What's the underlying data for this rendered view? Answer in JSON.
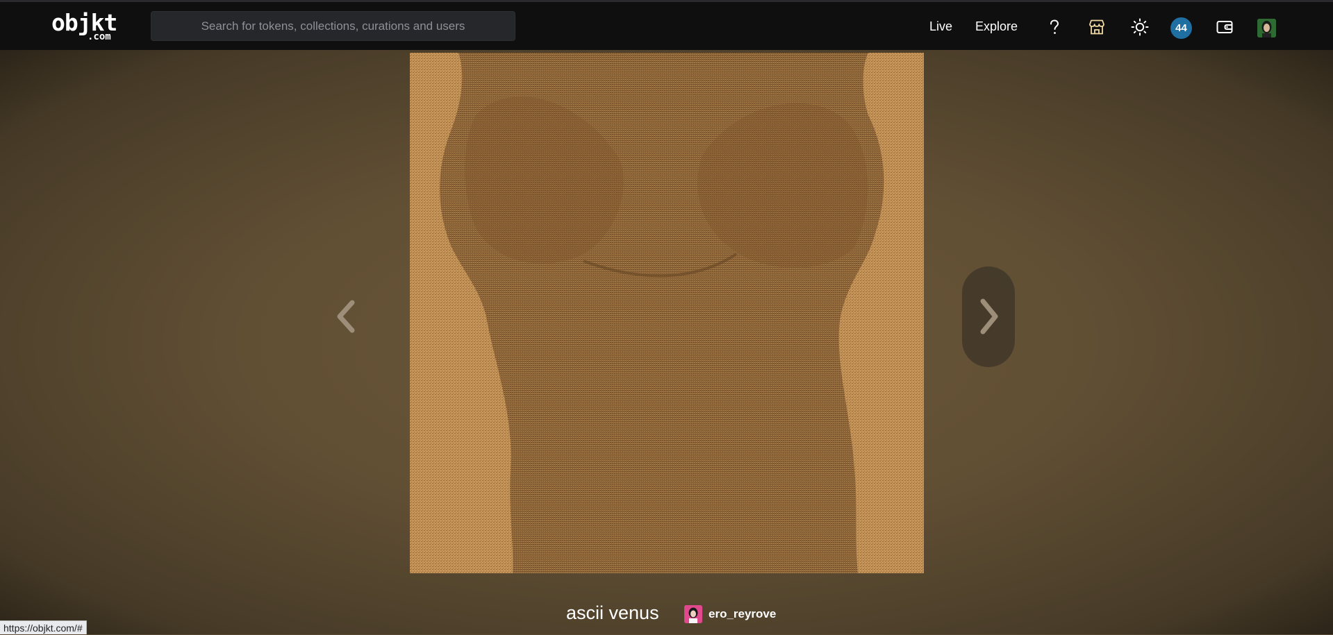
{
  "header": {
    "logo_main": "objkt",
    "logo_sub": ".com",
    "search_placeholder": "Search for tokens, collections, curations and users",
    "nav_live": "Live",
    "nav_explore": "Explore",
    "notification_count": "44",
    "icons": [
      "help-icon",
      "marketplace-icon",
      "theme-toggle-icon",
      "wallet-icon",
      "user-avatar"
    ]
  },
  "artwork": {
    "title": "ascii venus",
    "creator": "ero_reyrove",
    "background_color": "#c89558"
  },
  "status_bar": {
    "url": "https://objkt.com/#"
  },
  "colors": {
    "topbar": "#0f0f10",
    "accent_badge": "#1f6fa3",
    "stage": "#614f34"
  }
}
